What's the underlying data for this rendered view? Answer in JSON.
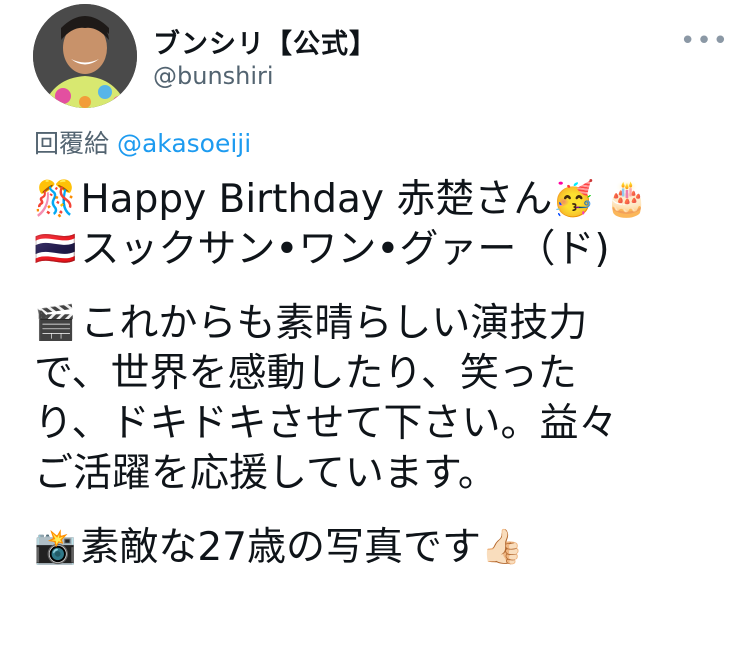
{
  "tweet": {
    "display_name": "ブンシリ【公式】",
    "handle": "@bunshiri",
    "more_label": "•••",
    "reply_prefix": "回覆給",
    "reply_mention": "@akasoeiji",
    "lines": [
      {
        "emoji": "🎊",
        "text": "Happy Birthday  赤楚さん",
        "emoji_after": "🥳 🎂"
      },
      {
        "emoji": "🇹🇭",
        "text": " スックサン•ワン•グァー（ド)",
        "emoji_after": ""
      },
      {
        "emoji": "🎬",
        "text": "これからも素晴らしい演技力",
        "emoji_after": ""
      },
      {
        "emoji": "",
        "text": "で、世界を感動したり、笑った",
        "emoji_after": ""
      },
      {
        "emoji": "",
        "text": "り、ドキドキさせて下さい。益々",
        "emoji_after": ""
      },
      {
        "emoji": "",
        "text": "ご活躍を応援しています。",
        "emoji_after": ""
      },
      {
        "emoji": "📸",
        "text": "素敵な27歳の写真です",
        "emoji_after": "👍🏻"
      }
    ]
  }
}
